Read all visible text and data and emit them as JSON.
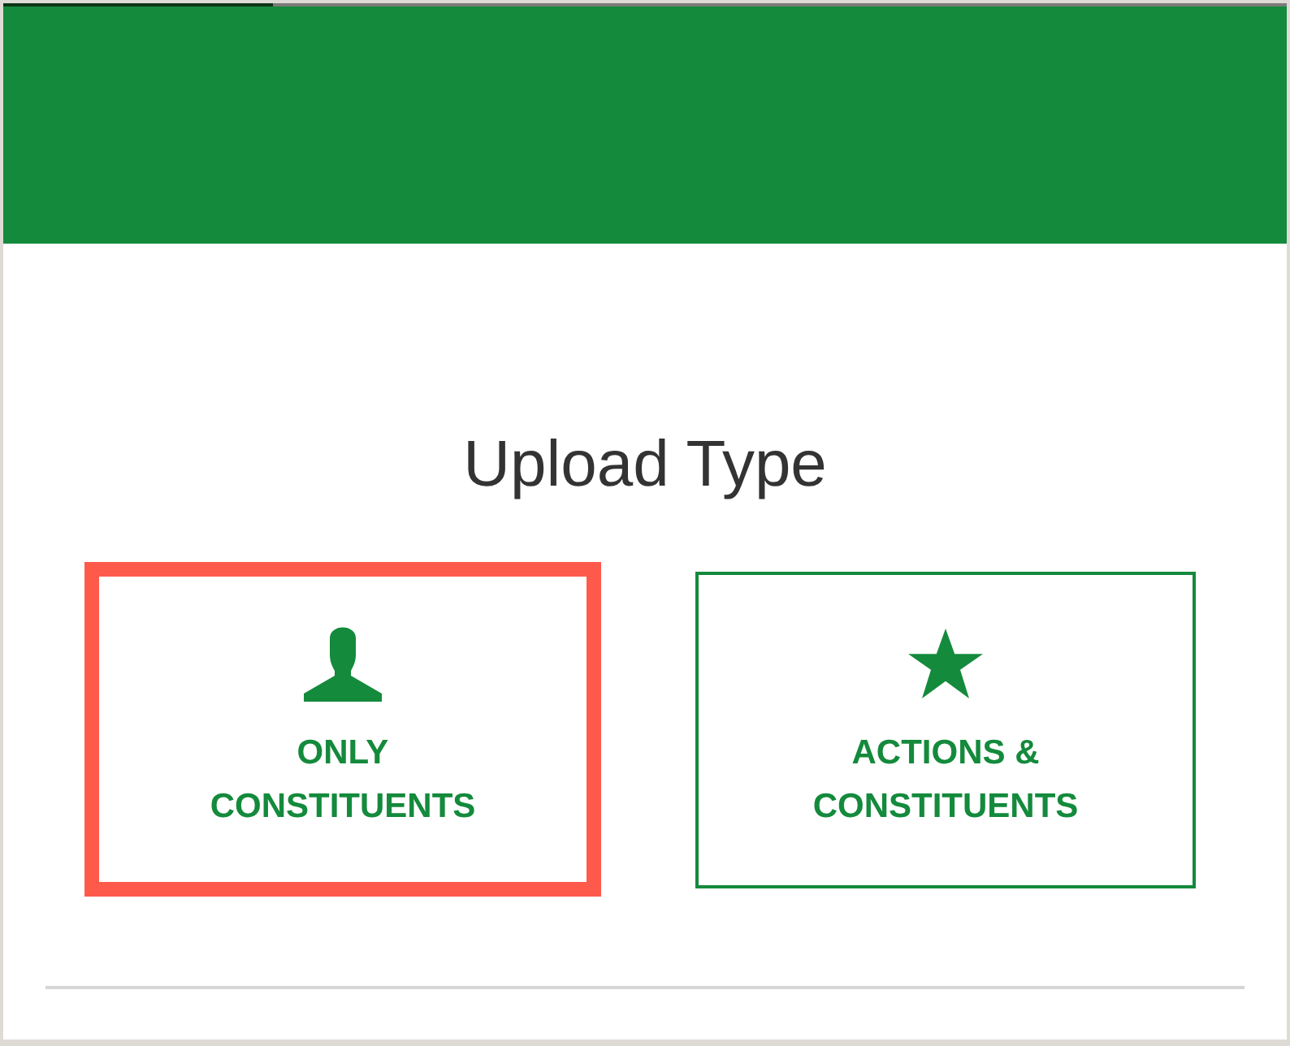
{
  "progress": {
    "level": 0.21
  },
  "title": "Upload Type",
  "options": [
    {
      "kind": "person",
      "label": "ONLY CONSTITUENTS",
      "selected": true
    },
    {
      "kind": "star",
      "label": "ACTIONS & CONSTITUENTS",
      "selected": false
    }
  ]
}
